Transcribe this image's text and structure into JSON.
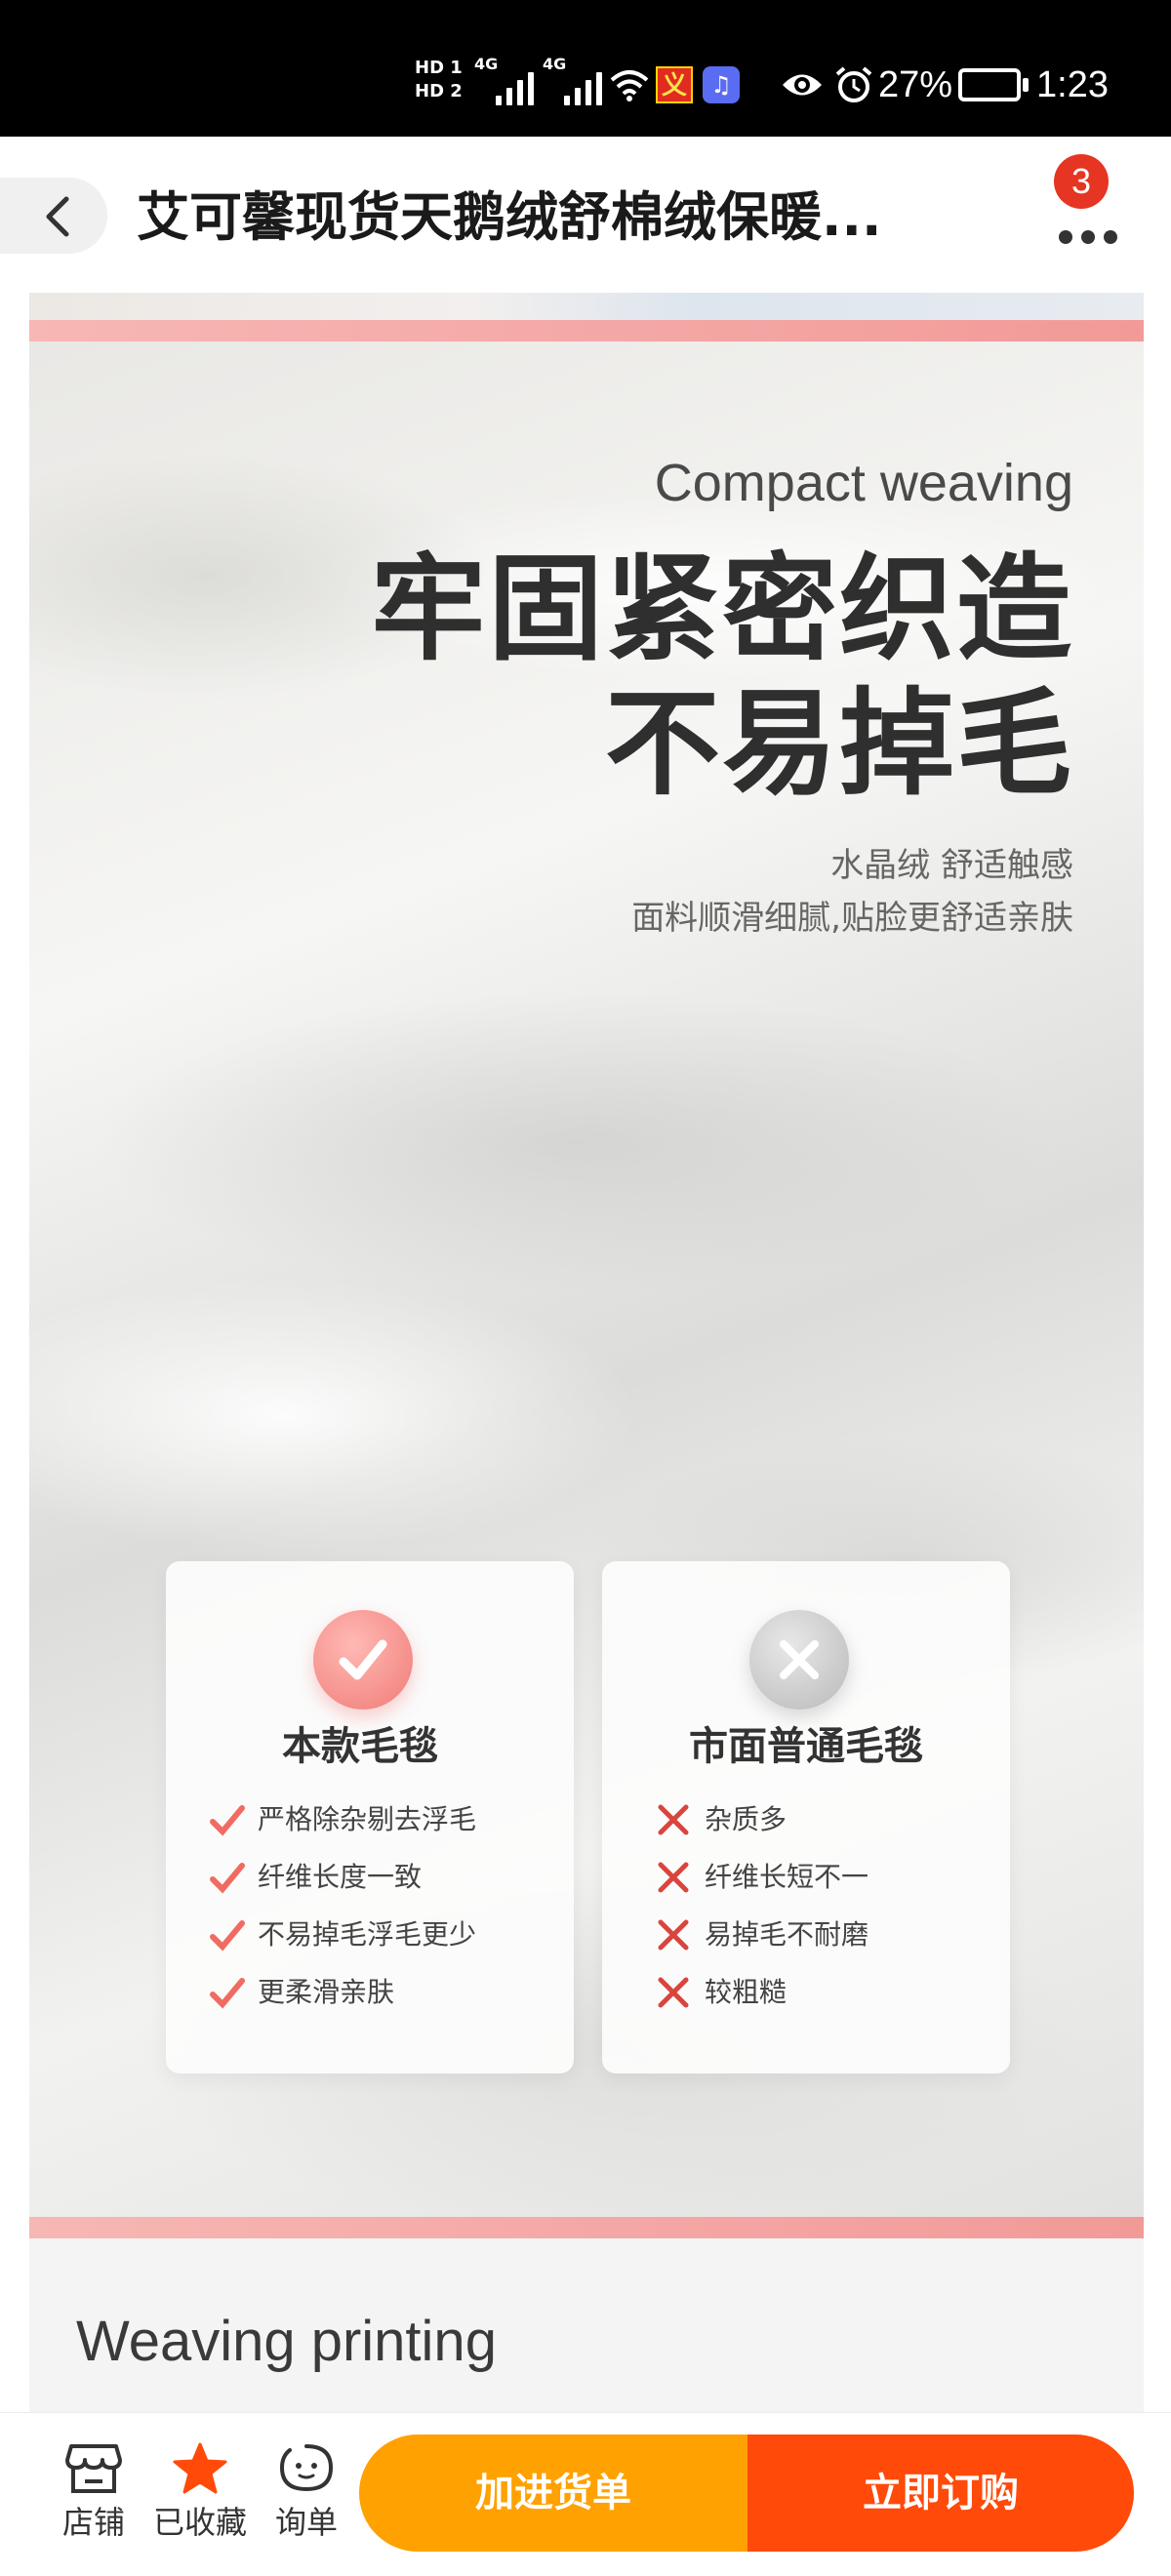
{
  "status_bar": {
    "network_1": "4G",
    "network_2": "4G",
    "battery": "27%",
    "time": "1:23",
    "icons": [
      "hd-icon",
      "signal-icon",
      "wifi-icon",
      "app-notification-icon",
      "music-icon",
      "eye-icon",
      "alarm-icon",
      "battery-icon"
    ]
  },
  "nav": {
    "title": "艾可馨现货天鹅绒舒棉绒保暖...",
    "badge_count": "3",
    "back_icon": "chevron-left-icon",
    "more_icon": "more-icon"
  },
  "content": {
    "english_heading": "Compact weaving",
    "chinese_heading": [
      "牢固紧密织造",
      "不易掉毛"
    ],
    "subtext": [
      "水晶绒 舒适触感",
      "面料顺滑细腻,贴脸更舒适亲肤"
    ],
    "comparison": {
      "ours": {
        "title": "本款毛毯",
        "items": [
          "严格除杂剔去浮毛",
          "纤维长度一致",
          "不易掉毛浮毛更少",
          "更柔滑亲肤"
        ]
      },
      "market": {
        "title": "市面普通毛毯",
        "items": [
          "杂质多",
          "纤维长短不一",
          "易掉毛不耐磨",
          "较粗糙"
        ]
      }
    },
    "next_heading": "Weaving printing"
  },
  "bottom_bar": {
    "store_label": "店铺",
    "favorite_label": "已收藏",
    "inquiry_label": "询单",
    "add_cart_label": "加进货单",
    "buy_label": "立即订购",
    "accent_orange": "#ffa100",
    "accent_red": "#ff4a0a"
  }
}
